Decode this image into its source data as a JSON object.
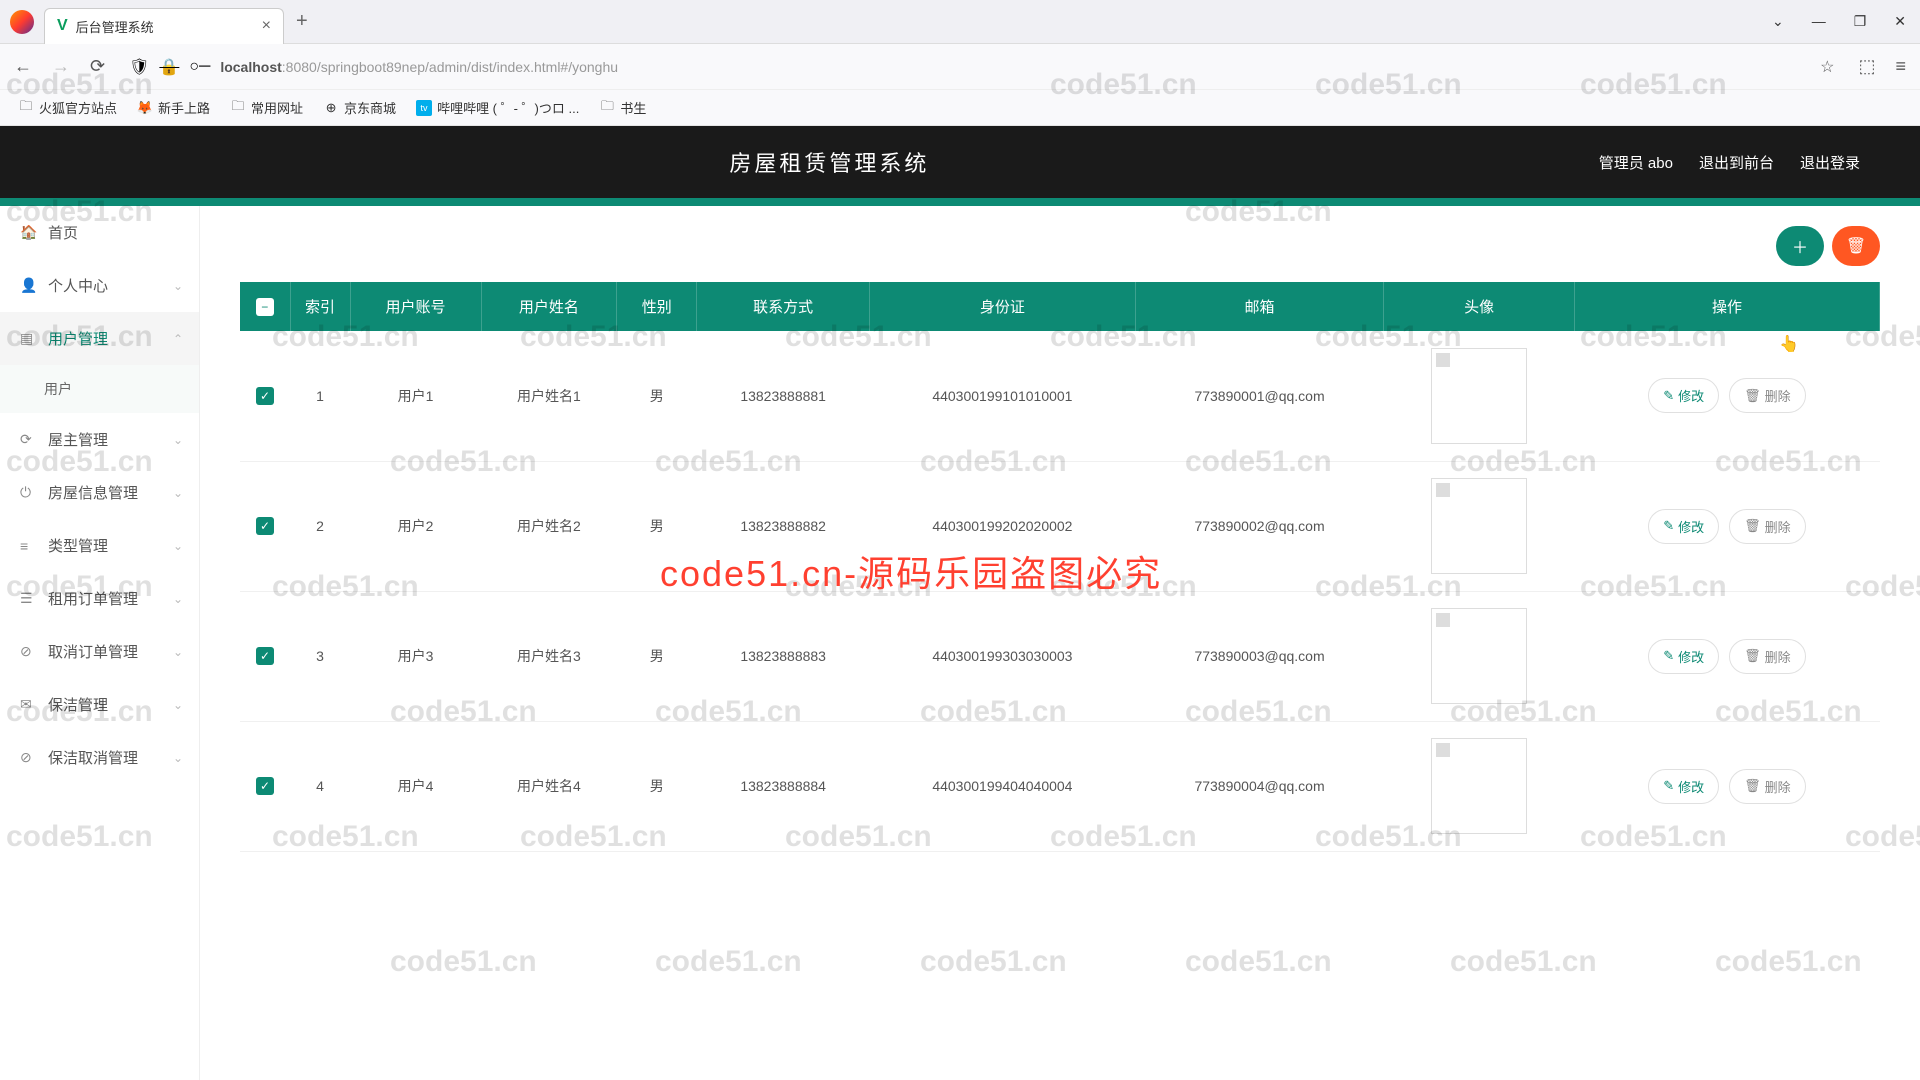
{
  "browser": {
    "tab_title": "后台管理系统",
    "url_host": "localhost",
    "url_path": ":8080/springboot89nep/admin/dist/index.html#/yonghu"
  },
  "bookmarks": [
    {
      "label": "火狐官方站点"
    },
    {
      "label": "新手上路"
    },
    {
      "label": "常用网址"
    },
    {
      "label": "京东商城"
    },
    {
      "label": "哔哩哔哩 ( ゜- ゜)つロ ..."
    },
    {
      "label": "书生"
    }
  ],
  "header": {
    "title": "房屋租赁管理系统",
    "admin": "管理员 abo",
    "to_front": "退出到前台",
    "logout": "退出登录"
  },
  "sidebar": [
    {
      "label": "首页",
      "icon": "🏠",
      "arrow": ""
    },
    {
      "label": "个人中心",
      "icon": "👤",
      "arrow": "⌄"
    },
    {
      "label": "用户管理",
      "icon": "▤",
      "arrow": "⌃",
      "active": true,
      "sub": [
        {
          "label": "用户"
        }
      ]
    },
    {
      "label": "屋主管理",
      "icon": "⟳",
      "arrow": "⌄"
    },
    {
      "label": "房屋信息管理",
      "icon": "⏻",
      "arrow": "⌄"
    },
    {
      "label": "类型管理",
      "icon": "≡",
      "arrow": "⌄"
    },
    {
      "label": "租用订单管理",
      "icon": "☰",
      "arrow": "⌄"
    },
    {
      "label": "取消订单管理",
      "icon": "⊘",
      "arrow": "⌄"
    },
    {
      "label": "保洁管理",
      "icon": "✉",
      "arrow": "⌄"
    },
    {
      "label": "保洁取消管理",
      "icon": "⊘",
      "arrow": "⌄"
    }
  ],
  "table": {
    "headers": [
      "",
      "索引",
      "用户账号",
      "用户姓名",
      "性别",
      "联系方式",
      "身份证",
      "邮箱",
      "头像",
      "操作"
    ],
    "op_edit": "修改",
    "op_del": "删除",
    "rows": [
      {
        "idx": "1",
        "account": "用户1",
        "name": "用户姓名1",
        "gender": "男",
        "phone": "13823888881",
        "id": "440300199101010001",
        "email": "773890001@qq.com"
      },
      {
        "idx": "2",
        "account": "用户2",
        "name": "用户姓名2",
        "gender": "男",
        "phone": "13823888882",
        "id": "440300199202020002",
        "email": "773890002@qq.com"
      },
      {
        "idx": "3",
        "account": "用户3",
        "name": "用户姓名3",
        "gender": "男",
        "phone": "13823888883",
        "id": "440300199303030003",
        "email": "773890003@qq.com"
      },
      {
        "idx": "4",
        "account": "用户4",
        "name": "用户姓名4",
        "gender": "男",
        "phone": "13823888884",
        "id": "440300199404040004",
        "email": "773890004@qq.com"
      }
    ]
  },
  "watermark": {
    "text": "code51.cn",
    "red": "code51.cn-源码乐园盗图必究"
  }
}
